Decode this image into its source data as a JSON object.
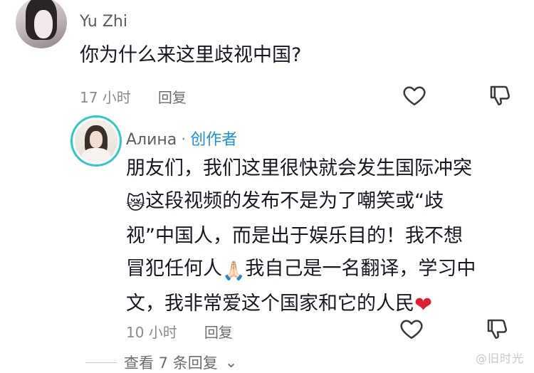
{
  "comment1": {
    "username": "Yu Zhi",
    "text": "你为什么来这里歧视中国?",
    "time": "17 小时",
    "reply_label": "回复"
  },
  "comment2": {
    "username": "Алина",
    "separator": "·",
    "creator_tag": "创作者",
    "lines": [
      "朋友们，我们这里很快就会发生国际冲突",
      "这段视频的发布不是为了嘲笑或“歧",
      "视”中国人，而是出于娱乐目的！我不想",
      "冒犯任何人",
      "我自己是一名翻译，学习中",
      "文，我非常爱这个国家和它的人民"
    ],
    "emoji_cat": "😿",
    "emoji_pray": "🙏🏻",
    "emoji_heart": "❤",
    "time": "10 小时",
    "reply_label": "回复"
  },
  "view_more": "查看 7 条回复",
  "view_more_chevron": "⌄",
  "watermark": "@旧时光",
  "colors": {
    "creator_tag": "#1e8fd8",
    "ring": "#2dc9c9",
    "heart": "#e0202f"
  },
  "icons": [
    "heart-outline-icon",
    "thumbs-down-icon",
    "chevron-down-icon"
  ]
}
